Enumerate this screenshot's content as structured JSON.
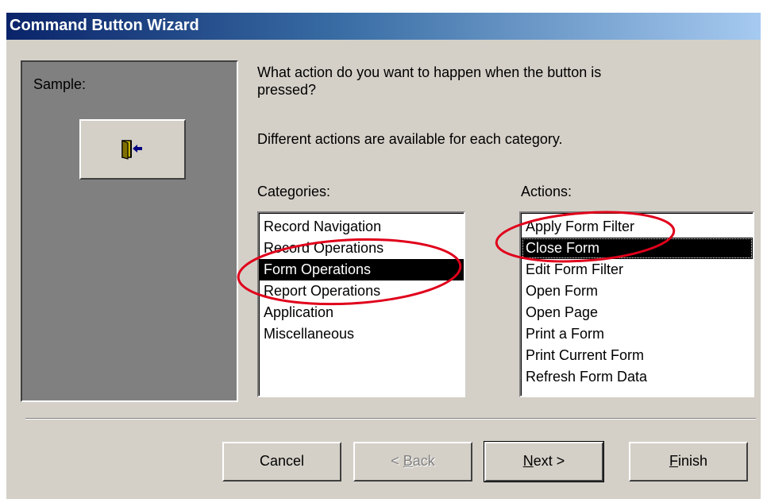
{
  "window": {
    "title": "Command Button Wizard"
  },
  "sample": {
    "label": "Sample:",
    "button_icon": "exit-door-icon"
  },
  "question": {
    "line1": "What action do you want to happen when the button is",
    "line2": "pressed?",
    "note": "Different actions are available for each category."
  },
  "categories": {
    "label": "Categories:",
    "items": [
      "Record Navigation",
      "Record Operations",
      "Form Operations",
      "Report Operations",
      "Application",
      "Miscellaneous"
    ],
    "selected": "Form Operations"
  },
  "actions": {
    "label": "Actions:",
    "items": [
      "Apply Form Filter",
      "Close Form",
      "Edit Form Filter",
      "Open Form",
      "Open Page",
      "Print a Form",
      "Print Current Form",
      "Refresh Form Data"
    ],
    "selected": "Close Form"
  },
  "buttons": {
    "cancel": "Cancel",
    "back": "< Back",
    "next": "Next >",
    "finish": "Finish"
  },
  "colors": {
    "face": "#d4d0c8",
    "title_start": "#0a246a",
    "title_end": "#a6caf0",
    "selection": "#000000",
    "annotation": "#e0001b"
  }
}
